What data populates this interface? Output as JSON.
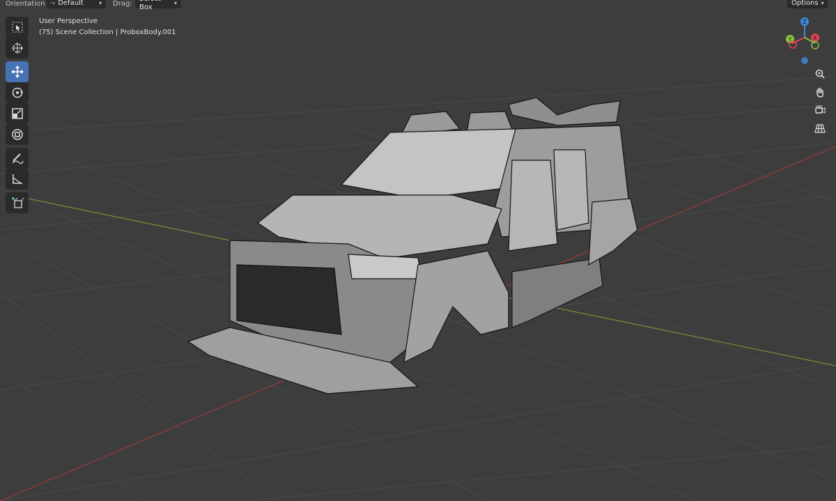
{
  "header": {
    "orientation_label": "Orientation:",
    "orientation_value": "Default",
    "drag_label": "Drag:",
    "drag_value": "Select Box",
    "options_label": "Options"
  },
  "viewport": {
    "perspective": "User Perspective",
    "collection": "(75) Scene Collection | ProboxBody.001"
  },
  "toolbar": {
    "tools": [
      {
        "name": "select-box",
        "icon": "select-box-icon"
      },
      {
        "name": "cursor",
        "icon": "cursor-icon"
      },
      {
        "name": "move",
        "icon": "move-icon",
        "active": true
      },
      {
        "name": "rotate",
        "icon": "rotate-icon"
      },
      {
        "name": "scale",
        "icon": "scale-icon"
      },
      {
        "name": "transform",
        "icon": "transform-icon"
      },
      {
        "name": "annotate",
        "icon": "annotate-icon"
      },
      {
        "name": "measure",
        "icon": "measure-icon"
      },
      {
        "name": "add-cube",
        "icon": "add-cube-icon"
      }
    ]
  },
  "gizmo": {
    "axis_x": "X",
    "axis_y": "Y",
    "axis_z": "Z",
    "colors": {
      "x": "#e44556",
      "y": "#8ac43f",
      "z": "#3f8bdc"
    }
  },
  "nav_buttons": [
    "zoom-icon",
    "hand-pan-icon",
    "camera-icon",
    "grid-perspective-icon"
  ],
  "colors": {
    "background": "#3d3d3d",
    "active_tool": "#4772b3",
    "x_axis_line": "#9b3b3b",
    "y_axis_line": "#7a8f3a"
  }
}
